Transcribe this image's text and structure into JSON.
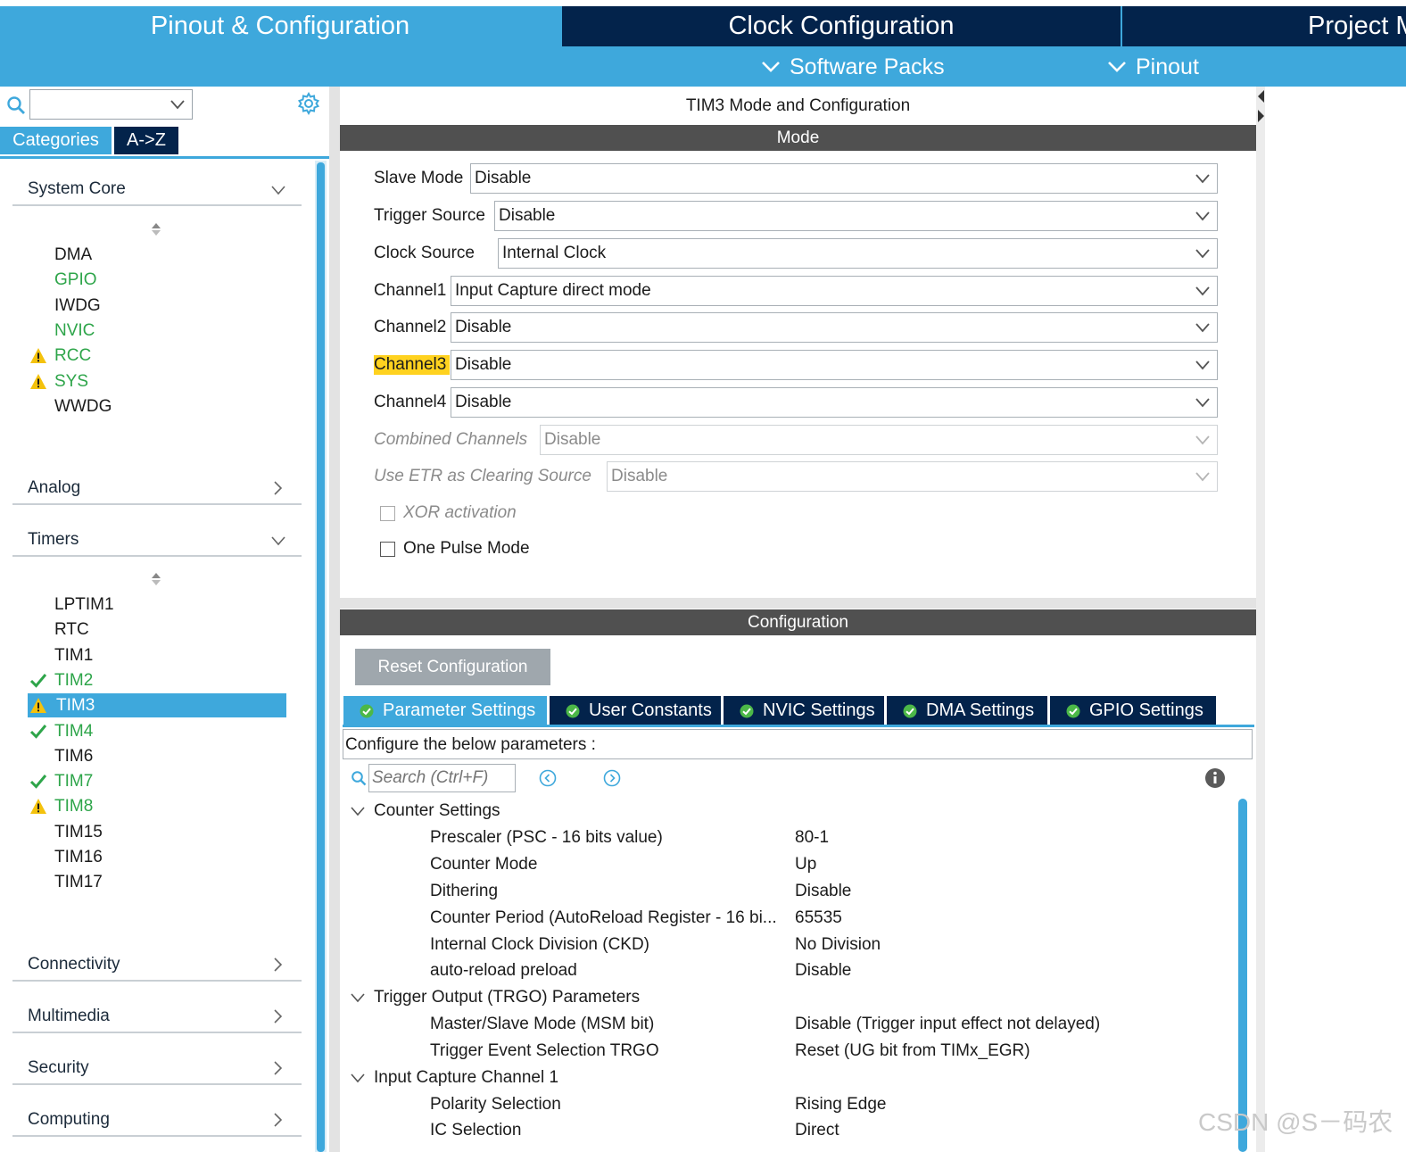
{
  "topnav": {
    "tabs": [
      "Pinout & Configuration",
      "Clock Configuration",
      "Project M"
    ],
    "software_packs": "Software Packs",
    "pinout": "Pinout"
  },
  "sidebar": {
    "search_value": "",
    "view_tabs": [
      "Categories",
      "A->Z"
    ],
    "categories": {
      "system_core": "System Core",
      "analog": "Analog",
      "timers": "Timers",
      "connectivity": "Connectivity",
      "multimedia": "Multimedia",
      "security": "Security",
      "computing": "Computing"
    },
    "system_core_items": [
      {
        "label": "DMA",
        "status": "none"
      },
      {
        "label": "GPIO",
        "status": "green"
      },
      {
        "label": "IWDG",
        "status": "none"
      },
      {
        "label": "NVIC",
        "status": "green"
      },
      {
        "label": "RCC",
        "status": "warning"
      },
      {
        "label": "SYS",
        "status": "warning"
      },
      {
        "label": "WWDG",
        "status": "none"
      }
    ],
    "timers_items": [
      {
        "label": "LPTIM1",
        "status": "none"
      },
      {
        "label": "RTC",
        "status": "none"
      },
      {
        "label": "TIM1",
        "status": "none"
      },
      {
        "label": "TIM2",
        "status": "check"
      },
      {
        "label": "TIM3",
        "status": "warning-selected"
      },
      {
        "label": "TIM4",
        "status": "check"
      },
      {
        "label": "TIM6",
        "status": "none"
      },
      {
        "label": "TIM7",
        "status": "check"
      },
      {
        "label": "TIM8",
        "status": "warning"
      },
      {
        "label": "TIM15",
        "status": "none"
      },
      {
        "label": "TIM16",
        "status": "none"
      },
      {
        "label": "TIM17",
        "status": "none"
      }
    ]
  },
  "panel": {
    "title": "TIM3 Mode and Configuration",
    "mode_header": "Mode",
    "config_header": "Configuration"
  },
  "mode": {
    "rows": [
      {
        "label": "Slave Mode",
        "value": "Disable"
      },
      {
        "label": "Trigger Source",
        "value": "Disable"
      },
      {
        "label": "Clock Source",
        "value": "Internal Clock"
      },
      {
        "label": "Channel1",
        "value": "Input Capture direct mode"
      },
      {
        "label": "Channel2",
        "value": "Disable"
      },
      {
        "label": "Channel3",
        "value": "Disable"
      },
      {
        "label": "Channel4",
        "value": "Disable"
      },
      {
        "label": "Combined Channels",
        "value": "Disable"
      },
      {
        "label": "Use ETR as Clearing Source",
        "value": "Disable"
      }
    ],
    "xor_activation": "XOR activation",
    "one_pulse_mode": "One Pulse Mode"
  },
  "config": {
    "reset_button": "Reset Configuration",
    "tabs": [
      "Parameter Settings",
      "User Constants",
      "NVIC Settings",
      "DMA Settings",
      "GPIO Settings"
    ],
    "description": "Configure the below parameters :",
    "search_placeholder": "Search (Ctrl+F)",
    "groups": {
      "counter": "Counter Settings",
      "trgo": "Trigger Output (TRGO) Parameters",
      "ic1": "Input Capture Channel 1"
    },
    "params": [
      {
        "name": "Prescaler (PSC - 16 bits value)",
        "value": "80-1"
      },
      {
        "name": "Counter Mode",
        "value": "Up"
      },
      {
        "name": "Dithering",
        "value": "Disable"
      },
      {
        "name": "Counter Period (AutoReload Register - 16 bi...",
        "value": "65535"
      },
      {
        "name": "Internal Clock Division (CKD)",
        "value": "No Division"
      },
      {
        "name": "auto-reload preload",
        "value": "Disable"
      },
      {
        "name": "Master/Slave Mode (MSM bit)",
        "value": "Disable (Trigger input effect not delayed)"
      },
      {
        "name": "Trigger Event Selection TRGO",
        "value": "Reset (UG bit from TIMx_EGR)"
      },
      {
        "name": "Polarity Selection",
        "value": "Rising Edge"
      },
      {
        "name": "IC Selection",
        "value": "Direct"
      }
    ]
  },
  "watermark": "CSDN @S－码农",
  "colors": {
    "accent_blue": "#3ea8dc",
    "navy": "#03234b",
    "section_gray": "#505050",
    "ok_green": "#2ea54a",
    "warning_yellow": "#f4c20d",
    "highlight_yellow": "#ffd21f"
  }
}
